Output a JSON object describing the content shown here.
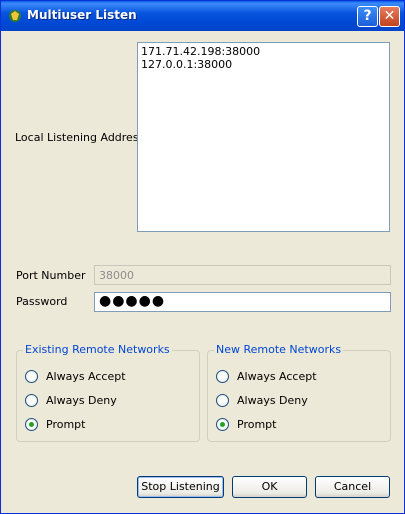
{
  "window": {
    "title": "Multiuser Listen",
    "help_icon": "question-mark",
    "close_icon": "x"
  },
  "form": {
    "local_address_label": "Local Listening Address:",
    "addresses": [
      "171.71.42.198:38000",
      "127.0.0.1:38000"
    ],
    "port_label": "Port Number",
    "port_value": "38000",
    "password_label": "Password",
    "password_value": "●●●●●"
  },
  "existing_networks": {
    "title": "Existing Remote Networks",
    "options": [
      {
        "label": "Always Accept",
        "checked": false
      },
      {
        "label": "Always Deny",
        "checked": false
      },
      {
        "label": "Prompt",
        "checked": true
      }
    ]
  },
  "new_networks": {
    "title": "New Remote Networks",
    "options": [
      {
        "label": "Always Accept",
        "checked": false
      },
      {
        "label": "Always Deny",
        "checked": false
      },
      {
        "label": "Prompt",
        "checked": true
      }
    ]
  },
  "buttons": {
    "stop": "Stop Listening",
    "ok": "OK",
    "cancel": "Cancel"
  }
}
